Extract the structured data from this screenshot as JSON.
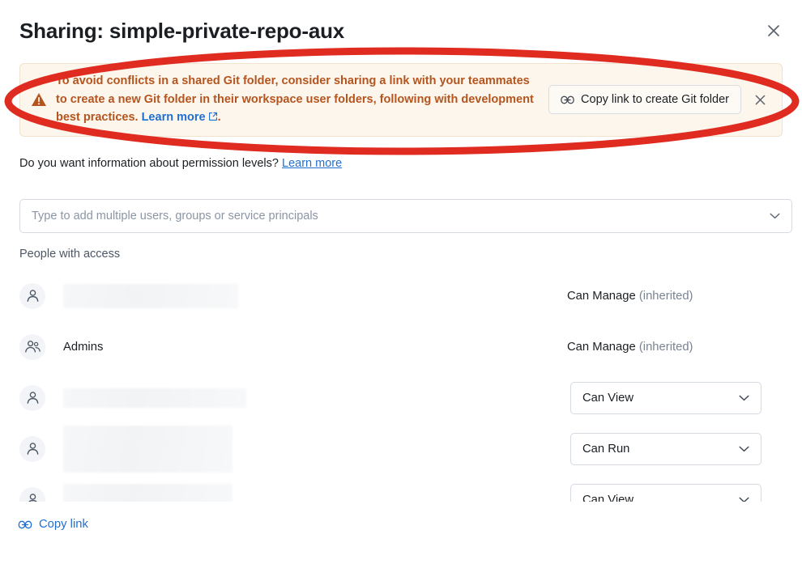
{
  "dialog": {
    "title": "Sharing: simple-private-repo-aux",
    "close_icon": "close-icon"
  },
  "warning_banner": {
    "icon": "warning-triangle-icon",
    "text_part1": "To avoid conflicts in a shared Git folder, consider sharing a link with your teammates to create a new Git folder in their workspace user folders, following with development best practices. ",
    "learn_more": "Learn more",
    "external_icon": "external-link-icon",
    "text_part2": ".",
    "action_button": {
      "icon": "link-icon",
      "label": "Copy link to create Git folder"
    },
    "close_icon": "close-icon",
    "background_color": "#fdf6ec",
    "text_color": "#b4551f",
    "link_color": "#1f6fd0"
  },
  "annotation": {
    "shape": "ellipse",
    "color": "#e02b20",
    "stroke_width": 9
  },
  "permission_info": {
    "text": "Do you want information about permission levels? ",
    "link": "Learn more"
  },
  "add_field": {
    "placeholder": "Type to add multiple users, groups or service principals",
    "value": "",
    "chevron_icon": "chevron-down-icon"
  },
  "people_section": {
    "label": "People with access",
    "rows": [
      {
        "icon": "person-icon",
        "name": "",
        "redacted": true,
        "redact_width": 216,
        "redact_height": 30,
        "permission_type": "static",
        "permission": "Can Manage",
        "permission_note": "(inherited)"
      },
      {
        "icon": "group-icon",
        "name": "Admins",
        "redacted": false,
        "permission_type": "static",
        "permission": "Can Manage",
        "permission_note": "(inherited)"
      },
      {
        "icon": "person-icon",
        "name": "",
        "redacted": true,
        "redact_width": 226,
        "redact_height": 24,
        "permission_type": "select",
        "permission": "Can View",
        "chevron_icon": "chevron-down-icon"
      },
      {
        "icon": "person-icon",
        "name": "",
        "redacted": true,
        "redact_width": 209,
        "redact_height": 58,
        "permission_type": "select",
        "permission": "Can Run",
        "chevron_icon": "chevron-down-icon"
      },
      {
        "icon": "person-icon",
        "name": "",
        "redacted": true,
        "redact_width": 209,
        "redact_height": 40,
        "permission_type": "select",
        "permission": "Can View",
        "chevron_icon": "chevron-down-icon"
      }
    ]
  },
  "footer": {
    "copy_link_icon": "link-icon",
    "copy_link_label": "Copy link"
  }
}
